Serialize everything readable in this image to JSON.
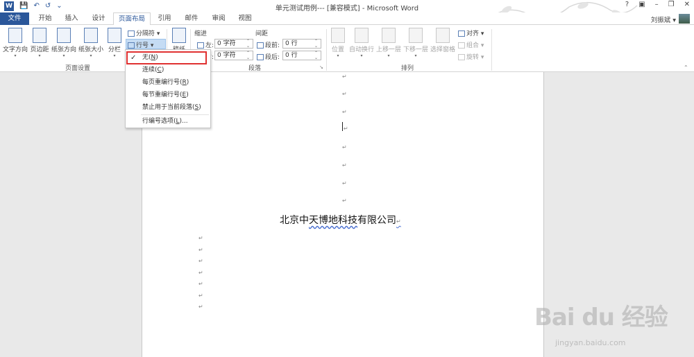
{
  "title_bar": {
    "doc_title": "单元测试用例--- [兼容模式] - Microsoft Word",
    "qat": [
      "W",
      "💾",
      "↶",
      "↺",
      "⌄"
    ],
    "controls": [
      "?",
      "▣",
      "–",
      "❐",
      "✕"
    ]
  },
  "tabs": [
    {
      "label": "文件",
      "key": "file"
    },
    {
      "label": "开始",
      "key": "home"
    },
    {
      "label": "插入",
      "key": "insert"
    },
    {
      "label": "设计",
      "key": "design"
    },
    {
      "label": "页面布局",
      "key": "layout"
    },
    {
      "label": "引用",
      "key": "references"
    },
    {
      "label": "邮件",
      "key": "mailings"
    },
    {
      "label": "审阅",
      "key": "review"
    },
    {
      "label": "视图",
      "key": "view"
    }
  ],
  "user": {
    "name": "刘振斌 ▾"
  },
  "ribbon": {
    "page_setup": {
      "label": "页面设置",
      "text_direction": "文字方向",
      "margins": "页边距",
      "orientation": "纸张方向",
      "size": "纸张大小",
      "columns": "分栏",
      "breaks": "分隔符 ▾",
      "line_numbers": "行号 ▾"
    },
    "draft": "稿纸",
    "paragraph": {
      "label": "段落",
      "indent": "缩进",
      "spacing": "间距",
      "left": "左:",
      "right": "右:",
      "left_val": "0 字符",
      "right_val": "0 字符",
      "before": "段前:",
      "after": "段后:",
      "before_val": "0 行",
      "after_val": "0 行"
    },
    "arrange": {
      "label": "排列",
      "position": "位置",
      "wrap": "自动换行",
      "forward": "上移一层",
      "backward": "下移一层",
      "pane": "选择窗格",
      "align": "对齐 ▾",
      "group": "组合 ▾",
      "rotate": "旋转 ▾"
    }
  },
  "line_number_menu": {
    "items": [
      {
        "label": "无(",
        "hot": "N",
        "tail": ")",
        "checked": true
      },
      {
        "label": "连续(",
        "hot": "C",
        "tail": ")"
      },
      {
        "label": "每页重编行号(",
        "hot": "R",
        "tail": ")"
      },
      {
        "label": "每节重编行号(",
        "hot": "E",
        "tail": ")"
      },
      {
        "label": "禁止用于当前段落(",
        "hot": "S",
        "tail": ")"
      },
      {
        "label": "行编号选项(",
        "hot": "L",
        "tail": ")..."
      }
    ],
    "check_mark": "✓"
  },
  "document": {
    "heading_pre": "北京中",
    "heading_mid": "天博地科技",
    "heading_post": "有限公司",
    "para_mark": "↵"
  },
  "watermark": {
    "brand": "Bai du 经验",
    "url": "jingyan.baidu.com"
  }
}
